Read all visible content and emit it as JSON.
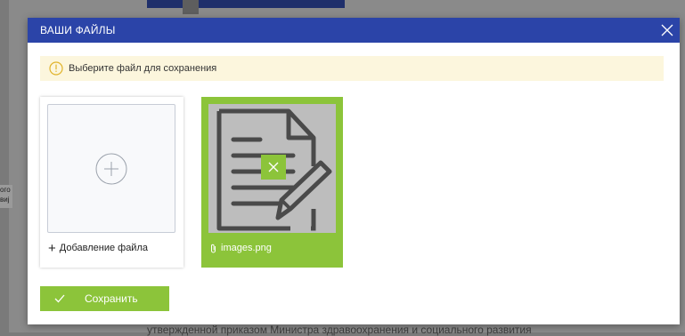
{
  "modal": {
    "title": "ВАШИ ФАЙЛЫ",
    "notice": "Выберите файл для сохранения",
    "add_file_label": "Добавление файла",
    "files": [
      {
        "name": "images.png"
      }
    ],
    "save_label": "Сохранить"
  },
  "background": {
    "bottom_text": "утвержденной приказом Министра здравоохранения и социального развития",
    "side_text": "ого\nвиј"
  },
  "colors": {
    "header": "#2b44a8",
    "accent_green": "#8cc43a",
    "notice_bg": "#fcf6dd",
    "notice_icon": "#e0b32a"
  },
  "icons": {
    "close": "close-icon",
    "info": "info-icon",
    "add": "plus-circle-icon",
    "document": "document-edit-icon",
    "remove": "close-icon",
    "attach": "paperclip-icon",
    "save": "check-icon"
  }
}
